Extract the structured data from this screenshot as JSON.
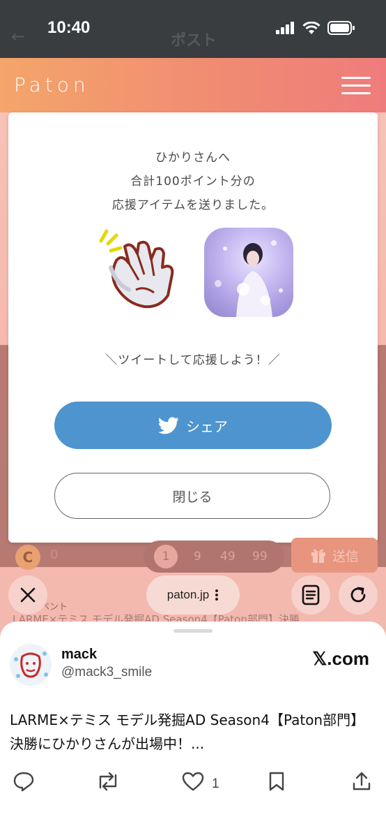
{
  "status_bar": {
    "time": "10:40",
    "underlying_title": "ポスト"
  },
  "app": {
    "logo": "Paton"
  },
  "modal": {
    "message_line1": "ひかりさんへ",
    "message_line2": "合計100ポイント分の",
    "message_line3": "応援アイテムを送りました。",
    "tweet_prompt": "＼ツイートして応援しよう！／",
    "share_label": "シェア",
    "close_label": "閉じる"
  },
  "points_row": {
    "coin_symbol": "C",
    "coin_balance": "0",
    "amounts": [
      "1",
      "9",
      "49",
      "99"
    ],
    "send_label": "送信"
  },
  "background_text": {
    "crumb_label": "ベント",
    "event_title": "LARME×テミス モデル発掘AD Season4【Paton部門】決勝"
  },
  "browser": {
    "url": "paton.jp"
  },
  "share_sheet": {
    "display_name": "mack",
    "handle": "@mack3_smile",
    "source": "𝕏.com",
    "post_text": "LARME×テミス モデル発掘AD Season4【Paton部門】決勝にひかりさんが出場中！...",
    "like_count": "1"
  },
  "colors": {
    "header_start": "#f4a56a",
    "header_end": "#ef7c7c",
    "share_button": "#4e94cf",
    "send_button": "#e8957f"
  }
}
